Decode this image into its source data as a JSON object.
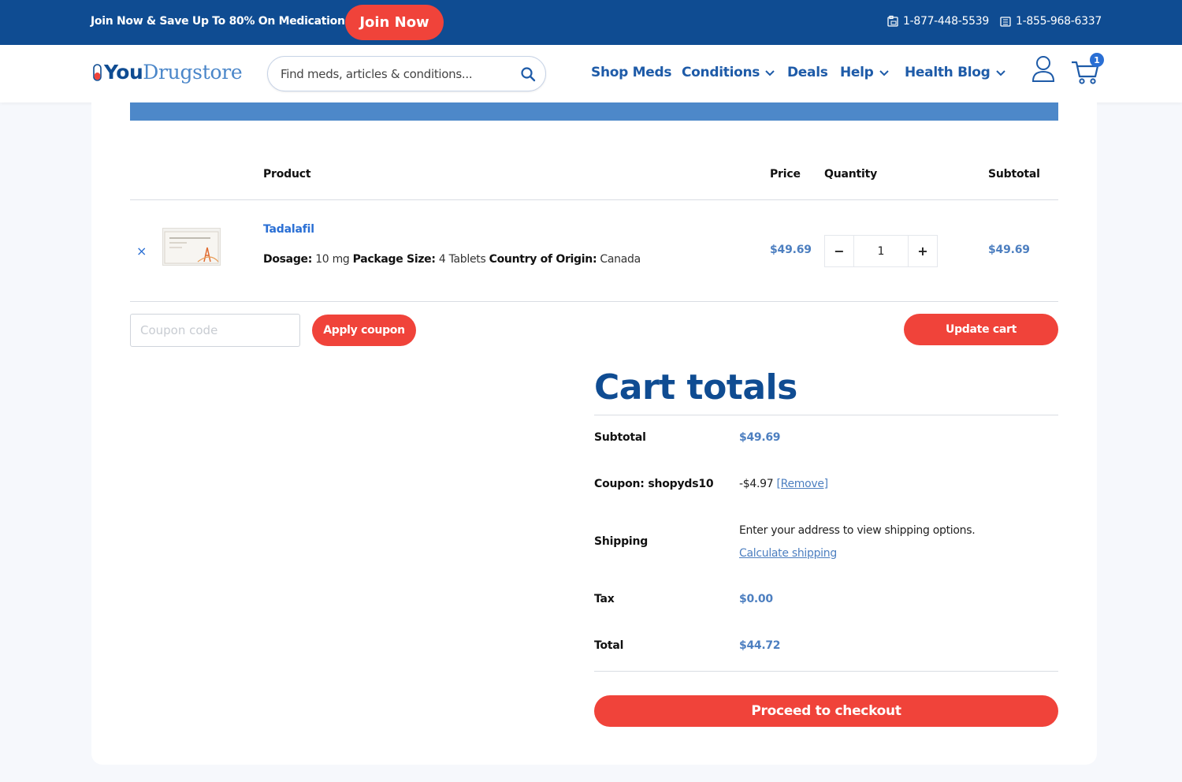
{
  "topbar": {
    "promo": "Join Now & Save Up To 80% On Medication",
    "join_label": "Join Now",
    "phone1": "1-877-448-5539",
    "phone2": "1-855-968-6337"
  },
  "header": {
    "logo_you": "You",
    "logo_drugstore": "Drugstore",
    "search_placeholder": "Find meds, articles & conditions...",
    "nav": [
      "Shop Meds",
      "Conditions",
      "Deals",
      "Help",
      "Health Blog"
    ],
    "cart_count": "1"
  },
  "table": {
    "headers": {
      "product": "Product",
      "price": "Price",
      "quantity": "Quantity",
      "subtotal": "Subtotal"
    },
    "remove_label": "×",
    "item": {
      "name": "Tadalafil",
      "dosage_label": "Dosage:",
      "dosage": "10 mg",
      "package_label": "Package Size:",
      "package": "4 Tablets",
      "origin_label": "Country of Origin:",
      "origin": "Canada",
      "price": "$49.69",
      "qty_minus": "−",
      "qty": "1",
      "qty_plus": "+",
      "subtotal": "$49.69"
    }
  },
  "coupon": {
    "placeholder": "Coupon code",
    "apply_label": "Apply coupon",
    "update_label": "Update cart"
  },
  "totals": {
    "title": "Cart totals",
    "subtotal_label": "Subtotal",
    "subtotal": "$49.69",
    "coupon_label": "Coupon: shopyds10",
    "coupon_amount": "-$4.97",
    "coupon_remove": "[Remove]",
    "shipping_label": "Shipping",
    "shipping_text": "Enter your address to view shipping options.",
    "shipping_link": "Calculate shipping",
    "tax_label": "Tax",
    "tax": "$0.00",
    "total_label": "Total",
    "total": "$44.72",
    "checkout_label": "Proceed to checkout"
  },
  "colors": {
    "brand_blue": "#0f4c92",
    "accent_red": "#f0433a",
    "link_blue": "#4d7fc0"
  }
}
